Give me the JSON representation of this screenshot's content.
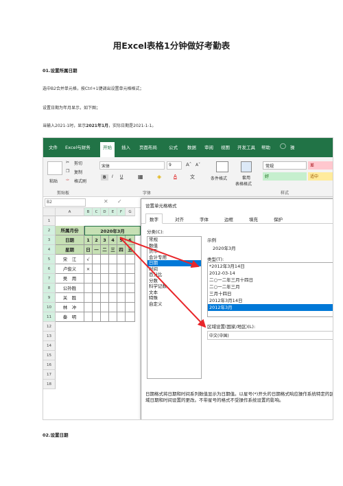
{
  "doc": {
    "title": "用Excel表格1分钟做好考勤表",
    "section1_heading": "01.设置所属日期",
    "para1": "选中B2合并单元格，按Ctrl+1键调出设置单元格格式；",
    "para2": "设置日期为年月显示，如下图；",
    "para3_pre": "当输入2021-1时，显示",
    "para3_bold": "2021年1月",
    "para3_post": "，实际日期是2021-1-1。",
    "section2_heading": "02.设置日期"
  },
  "excel": {
    "menu": [
      "文件",
      "Excel与财务",
      "开始",
      "插入",
      "页面布局",
      "公式",
      "数据",
      "审阅",
      "视图",
      "开发工具",
      "帮助",
      "操"
    ],
    "active_tab": "开始",
    "ribbon": {
      "paste": "粘贴",
      "cut": "剪切",
      "copy": "复制",
      "format_painter": "格式刷",
      "clipboard_group": "剪贴板",
      "font_name": "宋体",
      "font_size": "9",
      "font_group": "字体",
      "cond_format": "条件格式",
      "table_format_1": "套用",
      "table_format_2": "表格格式",
      "style_normal": "常规",
      "style_bad": "差",
      "style_good": "好",
      "style_neutral": "适中",
      "styles_group": "样式",
      "bold": "B",
      "italic": "I",
      "underline": "U"
    },
    "namebox": "B2",
    "columns": [
      "A",
      "B",
      "C",
      "D",
      "E",
      "F",
      "G"
    ],
    "rows": [
      "1",
      "2",
      "3",
      "4",
      "5",
      "6",
      "7",
      "8",
      "9",
      "10",
      "11",
      "12",
      "13",
      "14",
      "15",
      "16",
      "17",
      "18"
    ],
    "sheet": {
      "a2": "所属月份",
      "b2": "2020年3月",
      "a3": "日期",
      "days": [
        "1",
        "2",
        "3",
        "4",
        "5",
        "6"
      ],
      "a4": "星期",
      "weekdays": [
        "日",
        "一",
        "二",
        "三",
        "四",
        "五"
      ],
      "names": [
        "宋　江",
        "卢俊义",
        "吴　用",
        "公孙胜",
        "关　胜",
        "林　冲",
        "秦　明"
      ],
      "marks": [
        "√",
        "×"
      ]
    }
  },
  "dialog": {
    "title": "设置单元格格式",
    "tabs": [
      "数字",
      "对齐",
      "字体",
      "边框",
      "填充",
      "保护"
    ],
    "category_label": "分类(C):",
    "categories": [
      "常规",
      "数值",
      "货币",
      "会计专用",
      "日期",
      "时间",
      "百分比",
      "分数",
      "科学记数",
      "文本",
      "特殊",
      "自定义"
    ],
    "selected_category": "日期",
    "sample_label": "示例",
    "sample_value": "2020年3月",
    "type_label": "类型(T):",
    "types": [
      "*2012年3月14日",
      "2012-03-14",
      "二○一二年三月十四日",
      "二○一二年三月",
      "三月十四日",
      "2012年3月14日",
      "2012年3月"
    ],
    "selected_type": "2012年3月",
    "locale_label": "区域设置(国家/地区)(L):",
    "locale_value": "中文(中国)",
    "description": "日期格式将日期和时间系列数值显示为日期值。以星号(*)开头的日期格式响应操作系统特定的区域日期和时间设置的更改。不带星号的格式不受操作系统设置的影响。"
  },
  "colors": {
    "excel_green": "#217346",
    "header_fill": "#c6e0b4",
    "select_blue": "#0078d7",
    "arrow_red": "#e8262a"
  }
}
